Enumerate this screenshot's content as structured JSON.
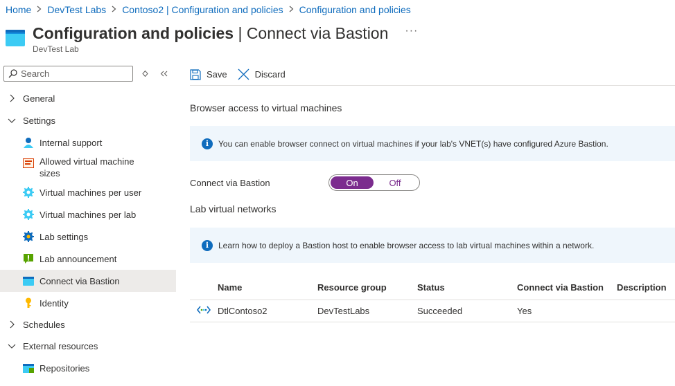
{
  "breadcrumb": [
    "Home",
    "DevTest Labs",
    "Contoso2 | Configuration and policies",
    "Configuration and policies"
  ],
  "header": {
    "title_bold": "Configuration and policies",
    "title_rest": " | Connect via Bastion",
    "subtitle": "DevTest Lab",
    "more": "···"
  },
  "search": {
    "placeholder": "Search"
  },
  "sidebar": {
    "items": [
      {
        "label": "General",
        "type": "group",
        "expanded": false
      },
      {
        "label": "Settings",
        "type": "group",
        "expanded": true
      },
      {
        "label": "Internal support",
        "type": "child",
        "icon": "person-icon"
      },
      {
        "label": "Allowed virtual machine sizes",
        "type": "child",
        "icon": "list-icon"
      },
      {
        "label": "Virtual machines per user",
        "type": "child",
        "icon": "gear-icon"
      },
      {
        "label": "Virtual machines per lab",
        "type": "child",
        "icon": "gear-icon"
      },
      {
        "label": "Lab settings",
        "type": "child",
        "icon": "settings-icon"
      },
      {
        "label": "Lab announcement",
        "type": "child",
        "icon": "announcement-icon"
      },
      {
        "label": "Connect via Bastion",
        "type": "child",
        "icon": "bastion-icon",
        "active": true
      },
      {
        "label": "Identity",
        "type": "child",
        "icon": "key-icon"
      },
      {
        "label": "Schedules",
        "type": "group",
        "expanded": false
      },
      {
        "label": "External resources",
        "type": "group",
        "expanded": true
      },
      {
        "label": "Repositories",
        "type": "child",
        "icon": "repository-icon"
      }
    ]
  },
  "toolbar": {
    "save_label": "Save",
    "discard_label": "Discard"
  },
  "main": {
    "browser_access_title": "Browser access to virtual machines",
    "info1": "You can enable browser connect on virtual machines if your lab's VNET(s) have configured Azure Bastion.",
    "toggle_label": "Connect via Bastion",
    "toggle_on": "On",
    "toggle_off": "Off",
    "toggle_value": "On",
    "lab_networks_title": "Lab virtual networks",
    "info2": "Learn how to deploy a Bastion host to enable browser access to lab virtual machines within a network."
  },
  "table": {
    "columns": [
      "Name",
      "Resource group",
      "Status",
      "Connect via Bastion",
      "Description"
    ],
    "rows": [
      {
        "name": "DtlContoso2",
        "resource_group": "DevTestLabs",
        "status": "Succeeded",
        "connect": "Yes",
        "description": ""
      }
    ]
  },
  "colors": {
    "accent": "#0f6cbd",
    "toggle": "#7b2c8e",
    "info_bg": "#eff6fc",
    "active_bg": "#edebe9"
  }
}
